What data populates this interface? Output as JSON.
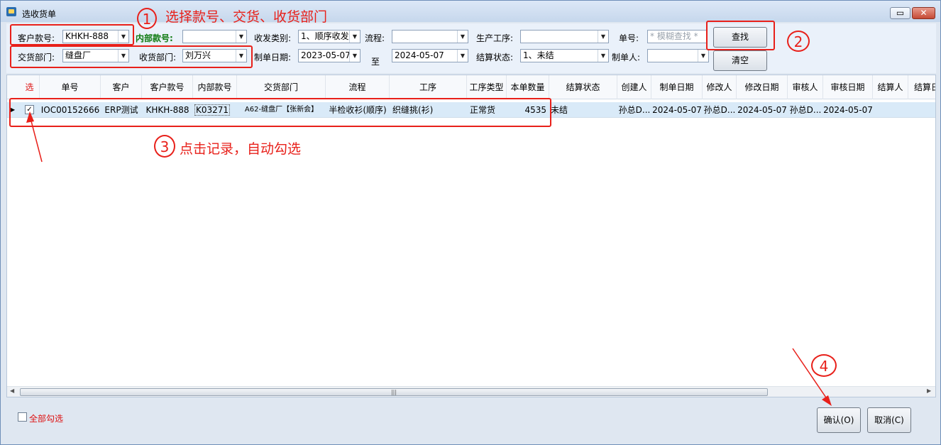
{
  "window": {
    "title": "选收货单",
    "minimize": "▭",
    "close": "✕"
  },
  "filters": {
    "customer_style_label": "客户款号:",
    "customer_style_value": "KHKH-888",
    "internal_style_label": "内部款号:",
    "internal_style_value": "",
    "send_type_label": "收发类别:",
    "send_type_value": "1、顺序收发",
    "flow_label": "流程:",
    "flow_value": "",
    "process_label": "生产工序:",
    "process_value": "",
    "order_no_label": "单号:",
    "order_no_placeholder": "* 模糊查找 *",
    "deliver_dept_label": "交货部门:",
    "deliver_dept_value": "缝盘厂",
    "receive_dept_label": "收货部门:",
    "receive_dept_value": "刘万兴",
    "date_label": "制单日期:",
    "date_from": "2023-05-07",
    "date_to_label": "至",
    "date_to": "2024-05-07",
    "settle_status_label": "结算状态:",
    "settle_status_value": "1、未结",
    "creator_label": "制单人:",
    "creator_value": "",
    "search_button": "查找",
    "clear_button": "清空"
  },
  "grid": {
    "columns": [
      "选",
      "单号",
      "客户",
      "客户款号",
      "内部款号",
      "交货部门",
      "流程",
      "工序",
      "工序类型",
      "本单数量",
      "结算状态",
      "创建人",
      "制单日期",
      "修改人",
      "修改日期",
      "审核人",
      "审核日期",
      "结算人",
      "结算日"
    ],
    "rows": [
      {
        "checked": "✓",
        "order_no": "IOC00152666",
        "customer": "ERP测试",
        "customer_style": "KHKH-888",
        "internal_style": "K03271",
        "deliver_dept": "A62-缝盘厂【张新会】",
        "flow": "半检收衫(顺序)",
        "process": "织缝挑(衫)",
        "process_type": "正常货",
        "quantity": "4535",
        "settle_status": "未结",
        "creator": "孙总D...",
        "create_date": "2024-05-07",
        "modifier": "孙总D...",
        "modify_date": "2024-05-07",
        "auditor": "孙总D...",
        "audit_date": "2024-05-07",
        "settler": "",
        "settle_date": ""
      }
    ]
  },
  "footer": {
    "select_all_label": "全部勾选",
    "confirm_button": "确认(O)",
    "cancel_button": "取消(C)"
  },
  "annotations": {
    "step1_number": "1",
    "step1_text": "选择款号、交货、收货部门",
    "step2_number": "2",
    "step3_number": "3",
    "step3_text": "点击记录，自动勾选",
    "step4_number": "4",
    "color": "#e8201a"
  }
}
